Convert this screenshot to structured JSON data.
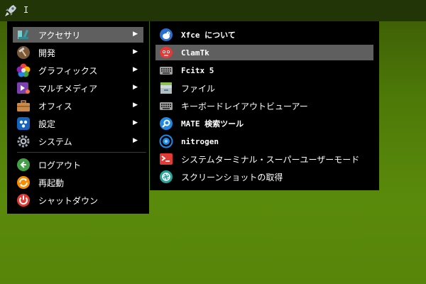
{
  "panel": {
    "launcher_icon": "rocket-icon",
    "cursor_glyph": "I"
  },
  "main_menu": {
    "items": [
      {
        "label": "アクセサリ",
        "icon": "accessories-icon",
        "has_submenu": true,
        "highlighted": true
      },
      {
        "label": "開発",
        "icon": "development-hammer-icon",
        "has_submenu": true
      },
      {
        "label": "グラフィックス",
        "icon": "graphics-icon",
        "has_submenu": true
      },
      {
        "label": "マルチメディア",
        "icon": "multimedia-icon",
        "has_submenu": true
      },
      {
        "label": "オフィス",
        "icon": "office-briefcase-icon",
        "has_submenu": true
      },
      {
        "label": "設定",
        "icon": "settings-icon",
        "has_submenu": true
      },
      {
        "label": "システム",
        "icon": "system-gear-icon",
        "has_submenu": true
      }
    ],
    "session_items": [
      {
        "label": "ログアウト",
        "icon": "logout-icon"
      },
      {
        "label": "再起動",
        "icon": "restart-icon"
      },
      {
        "label": "シャットダウン",
        "icon": "shutdown-icon"
      }
    ],
    "arrow": "▶"
  },
  "submenu": {
    "items": [
      {
        "label": "Xfce について",
        "icon": "xfce-mouse-icon"
      },
      {
        "label": "ClamTk",
        "icon": "clamtk-icon",
        "highlighted": true
      },
      {
        "label": "Fcitx 5",
        "icon": "keyboard-icon"
      },
      {
        "label": "ファイル",
        "icon": "file-manager-icon"
      },
      {
        "label": "キーボードレイアウトビューアー",
        "icon": "keyboard-layout-icon"
      },
      {
        "label": "MATE 検索ツール",
        "icon": "search-tool-icon"
      },
      {
        "label": "nitrogen",
        "icon": "nitrogen-icon"
      },
      {
        "label": "システムターミナル・スーパーユーザーモード",
        "icon": "terminal-root-icon"
      },
      {
        "label": "スクリーンショットの取得",
        "icon": "screenshot-icon"
      }
    ]
  },
  "colors": {
    "highlight": "#5f5f5f",
    "menu_bg": "#000000",
    "panel_bg": "#213507",
    "desktop": "#578509"
  }
}
